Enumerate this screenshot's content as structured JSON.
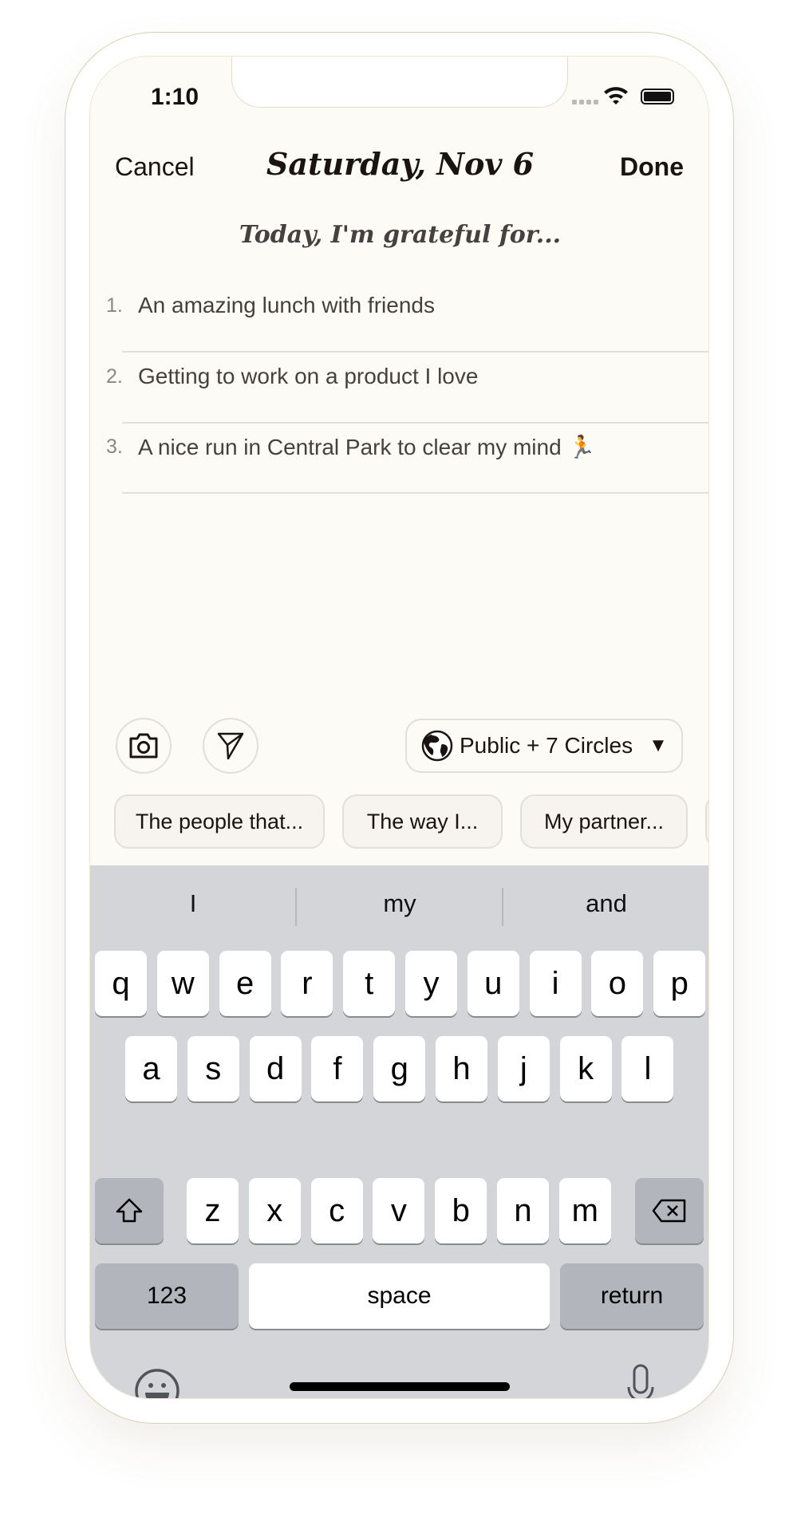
{
  "status_bar": {
    "time": "1:10"
  },
  "nav": {
    "cancel_label": "Cancel",
    "title": "Saturday, Nov 6",
    "done_label": "Done"
  },
  "prompt": "Today, I'm grateful for...",
  "entries": [
    {
      "number": "1.",
      "text": "An amazing lunch with friends"
    },
    {
      "number": "2.",
      "text": "Getting to work on a product I love"
    },
    {
      "number": "3.",
      "text": "A nice run in Central Park to clear my mind 🏃"
    }
  ],
  "toolbar": {
    "audience_label": "Public + 7 Circles",
    "audience_icon": "globe-icon",
    "camera_icon": "camera-icon",
    "send_icon": "send-icon"
  },
  "chips": [
    "The people that...",
    "The way I...",
    "My partner...",
    ""
  ],
  "keyboard": {
    "suggestions": [
      "I",
      "my",
      "and"
    ],
    "rows": [
      [
        "q",
        "w",
        "e",
        "r",
        "t",
        "y",
        "u",
        "i",
        "o",
        "p"
      ],
      [
        "a",
        "s",
        "d",
        "f",
        "g",
        "h",
        "j",
        "k",
        "l"
      ],
      [
        "z",
        "x",
        "c",
        "v",
        "b",
        "n",
        "m"
      ]
    ],
    "numbers_label": "123",
    "space_label": "space",
    "return_label": "return"
  },
  "colors": {
    "background": "#fdfbf5",
    "text": "#1a1311",
    "keyboard": "#d4d5d9"
  }
}
